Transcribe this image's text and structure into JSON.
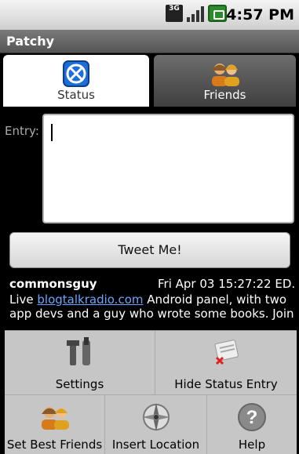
{
  "status_bar": {
    "network": "3G",
    "time": "4:57 PM"
  },
  "app": {
    "title": "Patchy"
  },
  "tabs": [
    {
      "label": "Status",
      "icon": "status-icon",
      "selected": true
    },
    {
      "label": "Friends",
      "icon": "friends-icon",
      "selected": false
    }
  ],
  "entry": {
    "label": "Entry:",
    "value": ""
  },
  "tweet_button": {
    "label": "Tweet Me!"
  },
  "timeline": [
    {
      "user": "commonsguy",
      "date": "Fri Apr 03 15:27:22 ED..",
      "text_before_link": "Live ",
      "link": "blogtalkradio.com",
      "text_after_link": " Android panel, with two app devs and a guy who wrote some books. Join"
    }
  ],
  "menu": {
    "items": [
      {
        "label": "Settings",
        "icon": "wrench-icon"
      },
      {
        "label": "Hide Status Entry",
        "icon": "hide-entry-icon"
      },
      {
        "label": "Set Best Friends",
        "icon": "friends-icon"
      },
      {
        "label": "Insert Location",
        "icon": "compass-icon"
      },
      {
        "label": "Help",
        "icon": "help-icon"
      }
    ]
  }
}
